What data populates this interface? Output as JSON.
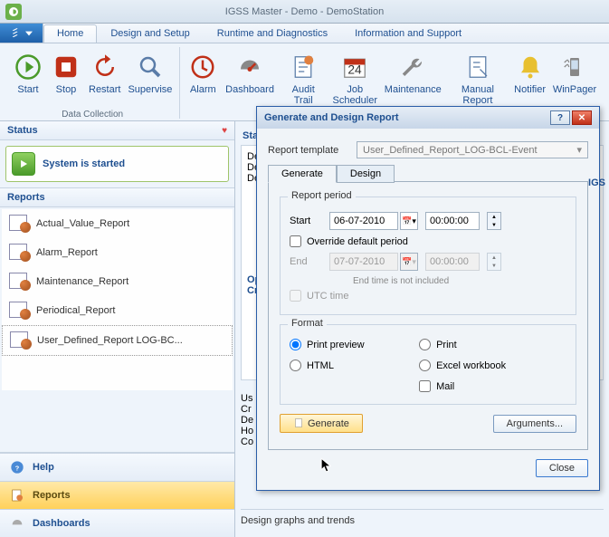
{
  "window": {
    "title": "IGSS Master - Demo - DemoStation"
  },
  "tabs": {
    "home": "Home",
    "design": "Design and Setup",
    "runtime": "Runtime and Diagnostics",
    "info": "Information and Support"
  },
  "ribbon": {
    "start": "Start",
    "stop": "Stop",
    "restart": "Restart",
    "supervise": "Supervise",
    "alarm": "Alarm",
    "dashboard": "Dashboard",
    "audit": "Audit Trail",
    "job": "Job\nScheduler",
    "maint": "Maintenance",
    "manual": "Manual\nReport Editor",
    "notifier": "Notifier",
    "winpager": "WinPager",
    "group_dc": "Data Collection"
  },
  "sidebar": {
    "status_hdr": "Status",
    "status_text": "System is started",
    "reports_hdr": "Reports",
    "reports": [
      "Actual_Value_Report",
      "Alarm_Report",
      "Maintenance_Report",
      "Periodical_Report",
      "User_Defined_Report LOG-BC..."
    ],
    "nav_help": "Help",
    "nav_reports": "Reports",
    "nav_dash": "Dashboards"
  },
  "main": {
    "stations_hdr": "Sta",
    "igss": "IGS",
    "de_rows": [
      "De",
      "De",
      "De"
    ],
    "op": "Op",
    "cr": "Cr",
    "letters": [
      "Us",
      "Cr",
      "De",
      "Ho",
      "Co"
    ],
    "stub": "Design graphs and trends"
  },
  "dialog": {
    "title": "Generate and Design Report",
    "template_label": "Report template",
    "template_value": "User_Defined_Report_LOG-BCL-Event",
    "tab_generate": "Generate",
    "tab_design": "Design",
    "period_legend": "Report period",
    "start_label": "Start",
    "start_date": "06-07-2010",
    "start_time": "00:00:00",
    "override": "Override default period",
    "end_label": "End",
    "end_date": "07-07-2010",
    "end_time": "00:00:00",
    "end_hint": "End time is not included",
    "utc": "UTC time",
    "format_legend": "Format",
    "fmt_preview": "Print preview",
    "fmt_print": "Print",
    "fmt_html": "HTML",
    "fmt_excel": "Excel workbook",
    "fmt_mail": "Mail",
    "generate_btn": "Generate",
    "arguments_btn": "Arguments...",
    "close_btn": "Close"
  }
}
